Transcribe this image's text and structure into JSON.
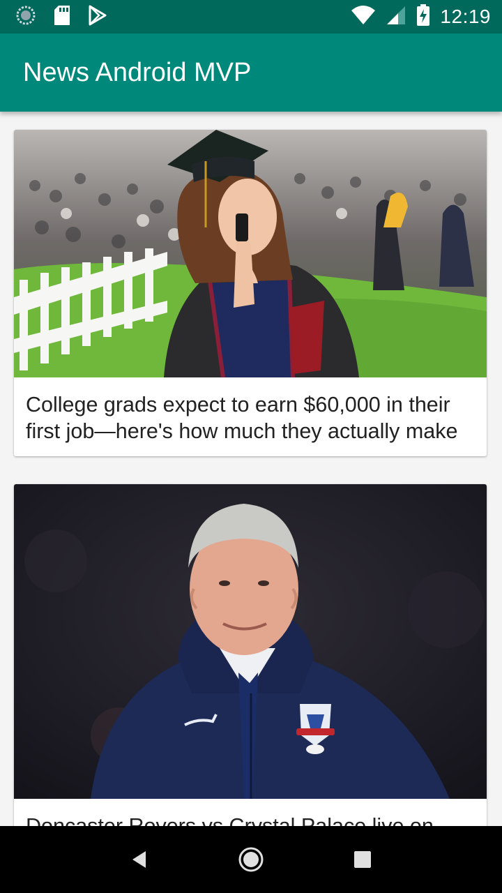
{
  "status_bar": {
    "time": "12:19",
    "left_icons": [
      "sync-icon",
      "sd-card-icon",
      "play-store-icon"
    ],
    "right_icons": [
      "wifi-icon",
      "signal-icon",
      "battery-charging-icon"
    ]
  },
  "app_bar": {
    "title": "News Android MVP",
    "color": "#00897b",
    "status_color": "#00695c"
  },
  "articles": [
    {
      "title": "College grads expect to earn $60,000 in their first job—here's how much they actually make",
      "image": "graduation-photo"
    },
    {
      "title": "Doncaster Rovers vs Crystal Palace live on",
      "image": "football-manager-photo"
    }
  ],
  "nav_bar": {
    "buttons": [
      "back-icon",
      "home-icon",
      "recents-icon"
    ]
  }
}
